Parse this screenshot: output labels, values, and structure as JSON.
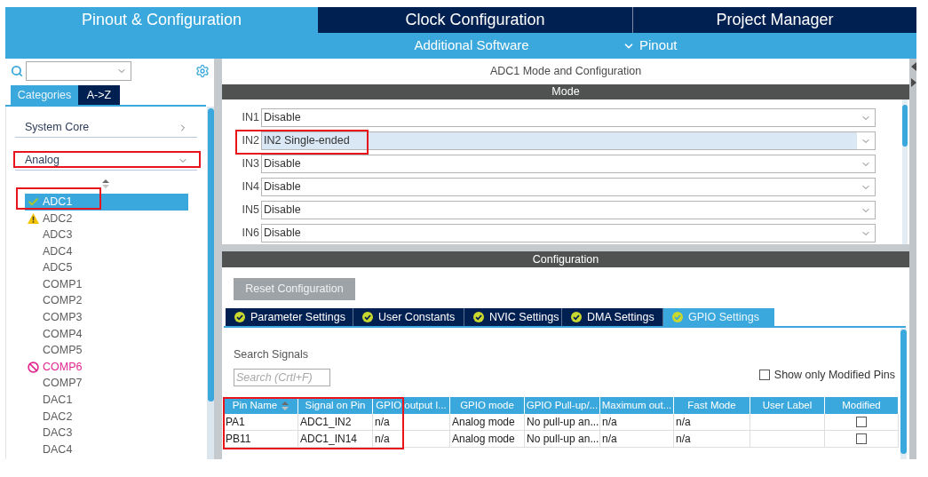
{
  "top_tabs": [
    {
      "label": "Pinout & Configuration",
      "selected": true
    },
    {
      "label": "Clock Configuration",
      "selected": false
    },
    {
      "label": "Project Manager",
      "selected": false
    }
  ],
  "sub_bar": [
    {
      "label": "Additional Software",
      "kind": "link"
    },
    {
      "label": "Pinout",
      "kind": "dropdown"
    }
  ],
  "left_panel": {
    "view_tabs": [
      {
        "label": "Categories",
        "selected": true
      },
      {
        "label": "A->Z",
        "selected": false
      }
    ],
    "categories": [
      {
        "label": "System Core",
        "expanded": false,
        "highlighted": false
      },
      {
        "label": "Analog",
        "expanded": true,
        "highlighted": true,
        "items": [
          {
            "label": "ADC1",
            "kind": "ok",
            "selected": true,
            "highlighted": true
          },
          {
            "label": "ADC2",
            "kind": "warning",
            "selected": false,
            "highlighted": false
          },
          {
            "label": "ADC3",
            "kind": "plain",
            "selected": false,
            "highlighted": false
          },
          {
            "label": "ADC4",
            "kind": "plain",
            "selected": false,
            "highlighted": false
          },
          {
            "label": "ADC5",
            "kind": "plain",
            "selected": false,
            "highlighted": false
          },
          {
            "label": "COMP1",
            "kind": "plain",
            "selected": false,
            "highlighted": false
          },
          {
            "label": "COMP2",
            "kind": "plain",
            "selected": false,
            "highlighted": false
          },
          {
            "label": "COMP3",
            "kind": "plain",
            "selected": false,
            "highlighted": false
          },
          {
            "label": "COMP4",
            "kind": "plain",
            "selected": false,
            "highlighted": false
          },
          {
            "label": "COMP5",
            "kind": "plain",
            "selected": false,
            "highlighted": false
          },
          {
            "label": "COMP6",
            "kind": "blocked",
            "selected": false,
            "highlighted": false
          },
          {
            "label": "COMP7",
            "kind": "plain",
            "selected": false,
            "highlighted": false
          },
          {
            "label": "DAC1",
            "kind": "plain",
            "selected": false,
            "highlighted": false
          },
          {
            "label": "DAC2",
            "kind": "plain",
            "selected": false,
            "highlighted": false
          },
          {
            "label": "DAC3",
            "kind": "plain",
            "selected": false,
            "highlighted": false
          },
          {
            "label": "DAC4",
            "kind": "plain",
            "selected": false,
            "highlighted": false
          }
        ]
      }
    ]
  },
  "right_panel": {
    "title": "ADC1 Mode and Configuration",
    "mode": {
      "header": "Mode",
      "rows": [
        {
          "label": "IN1",
          "value": "Disable",
          "selected": false,
          "highlighted": false
        },
        {
          "label": "IN2",
          "value": "IN2 Single-ended",
          "selected": true,
          "highlighted": true
        },
        {
          "label": "IN3",
          "value": "Disable",
          "selected": false,
          "highlighted": false
        },
        {
          "label": "IN4",
          "value": "Disable",
          "selected": false,
          "highlighted": false
        },
        {
          "label": "IN5",
          "value": "Disable",
          "selected": false,
          "highlighted": false
        },
        {
          "label": "IN6",
          "value": "Disable",
          "selected": false,
          "highlighted": false
        }
      ]
    },
    "configuration": {
      "header": "Configuration",
      "reset_button": "Reset Configuration",
      "tabs": [
        {
          "label": "Parameter Settings",
          "selected": false
        },
        {
          "label": "User Constants",
          "selected": false
        },
        {
          "label": "NVIC Settings",
          "selected": false
        },
        {
          "label": "DMA Settings",
          "selected": false
        },
        {
          "label": "GPIO Settings",
          "selected": true
        }
      ],
      "gpio": {
        "search_label": "Search Signals",
        "search_placeholder": "Search (Crtl+F)",
        "filter": {
          "label": "Show only Modified Pins",
          "checked": false
        },
        "table": {
          "highlighted": true,
          "columns": [
            {
              "label": "Pin Name",
              "sorted": true,
              "kind": "text"
            },
            {
              "label": "Signal on Pin",
              "sorted": false,
              "kind": "text"
            },
            {
              "label": "GPIO output l...",
              "sorted": false,
              "kind": "text"
            },
            {
              "label": "GPIO mode",
              "sorted": false,
              "kind": "text"
            },
            {
              "label": "GPIO Pull-up/...",
              "sorted": false,
              "kind": "text"
            },
            {
              "label": "Maximum out...",
              "sorted": false,
              "kind": "text"
            },
            {
              "label": "Fast Mode",
              "sorted": false,
              "kind": "text"
            },
            {
              "label": "User Label",
              "sorted": false,
              "kind": "text"
            },
            {
              "label": "Modified",
              "sorted": false,
              "kind": "checkbox"
            }
          ],
          "rows": [
            {
              "cells": [
                "PA1",
                "ADC1_IN2",
                "n/a",
                "Analog mode",
                "No pull-up an...",
                "n/a",
                "n/a"
              ],
              "modified": false
            },
            {
              "cells": [
                "PB11",
                "ADC1_IN14",
                "n/a",
                "Analog mode",
                "No pull-up an...",
                "n/a",
                "n/a"
              ],
              "modified": false
            }
          ]
        }
      }
    }
  }
}
